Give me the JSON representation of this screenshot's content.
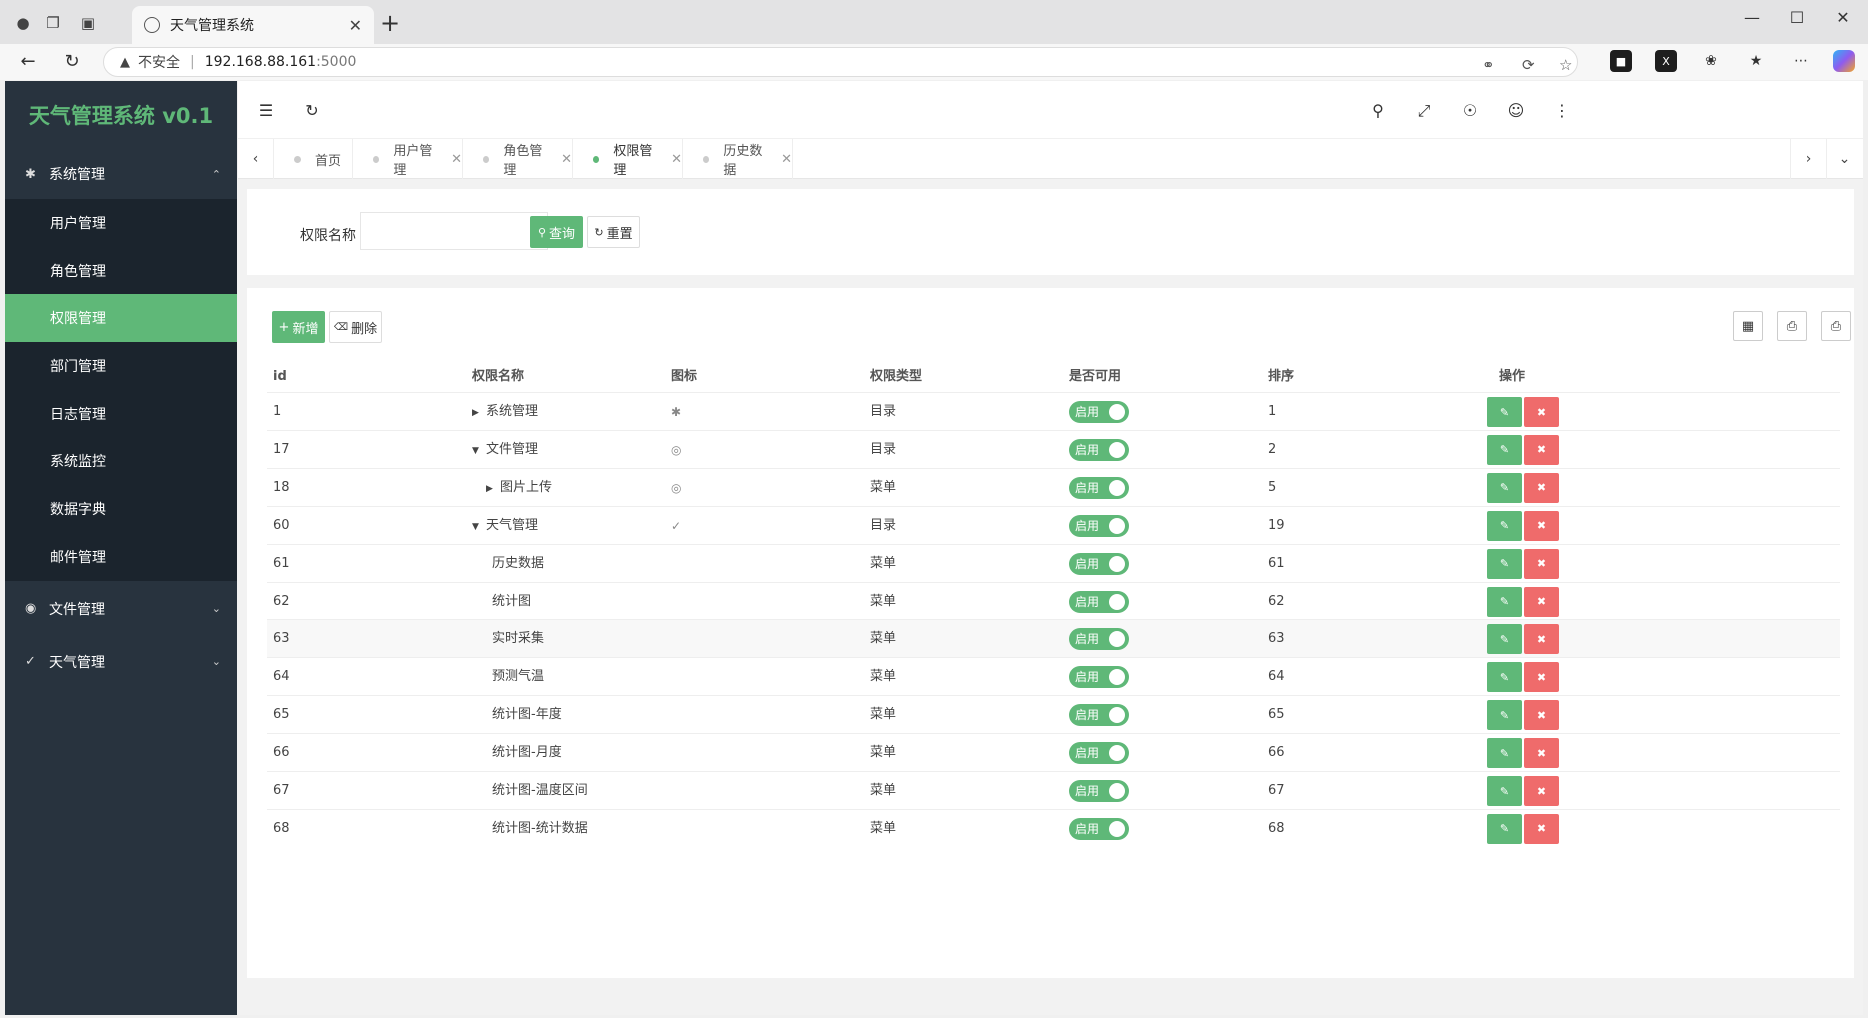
{
  "browser": {
    "tab_title": "天气管理系统",
    "address": {
      "insecure_label": "不安全",
      "host": "192.168.88.161",
      "port": ":5000"
    }
  },
  "sidebar": {
    "brand": "天气管理系统 v0.1",
    "groups": [
      {
        "label": "系统管理",
        "icon": "gear-icon",
        "expanded": true,
        "items": [
          "用户管理",
          "角色管理",
          "权限管理",
          "部门管理",
          "日志管理",
          "系统监控",
          "数据字典",
          "邮件管理"
        ],
        "active_item": "权限管理"
      },
      {
        "label": "文件管理",
        "icon": "camera-icon",
        "expanded": false
      },
      {
        "label": "天气管理",
        "icon": "check-icon",
        "expanded": false
      }
    ]
  },
  "tabs": [
    {
      "label": "首页",
      "closable": false,
      "active": false
    },
    {
      "label": "用户管理",
      "closable": true,
      "active": false
    },
    {
      "label": "角色管理",
      "closable": true,
      "active": false
    },
    {
      "label": "权限管理",
      "closable": true,
      "active": true
    },
    {
      "label": "历史数据",
      "closable": true,
      "active": false
    }
  ],
  "search": {
    "label": "权限名称",
    "value": "",
    "query_button": "查询",
    "reset_button": "重置"
  },
  "toolbar": {
    "add_button": "新增",
    "delete_button": "删除"
  },
  "table": {
    "columns": [
      "id",
      "权限名称",
      "图标",
      "权限类型",
      "是否可用",
      "排序",
      "操作"
    ],
    "switch_label": "启用",
    "rows": [
      {
        "id": "1",
        "name": "系统管理",
        "icon": "gear-icon",
        "caret": "collapsed",
        "indent": 0,
        "type": "目录",
        "enabled": true,
        "sort": "1"
      },
      {
        "id": "17",
        "name": "文件管理",
        "icon": "camera-icon",
        "caret": "expanded",
        "indent": 0,
        "type": "目录",
        "enabled": true,
        "sort": "2"
      },
      {
        "id": "18",
        "name": "图片上传",
        "icon": "camera-icon",
        "caret": "collapsed",
        "indent": 1,
        "type": "菜单",
        "enabled": true,
        "sort": "5"
      },
      {
        "id": "60",
        "name": "天气管理",
        "icon": "check-icon",
        "caret": "expanded",
        "indent": 0,
        "type": "目录",
        "enabled": true,
        "sort": "19"
      },
      {
        "id": "61",
        "name": "历史数据",
        "icon": "",
        "caret": "",
        "indent": 1,
        "type": "菜单",
        "enabled": true,
        "sort": "61"
      },
      {
        "id": "62",
        "name": "统计图",
        "icon": "",
        "caret": "",
        "indent": 1,
        "type": "菜单",
        "enabled": true,
        "sort": "62"
      },
      {
        "id": "63",
        "name": "实时采集",
        "icon": "",
        "caret": "",
        "indent": 1,
        "type": "菜单",
        "enabled": true,
        "sort": "63"
      },
      {
        "id": "64",
        "name": "预测气温",
        "icon": "",
        "caret": "",
        "indent": 1,
        "type": "菜单",
        "enabled": true,
        "sort": "64"
      },
      {
        "id": "65",
        "name": "统计图-年度",
        "icon": "",
        "caret": "",
        "indent": 1,
        "type": "菜单",
        "enabled": true,
        "sort": "65"
      },
      {
        "id": "66",
        "name": "统计图-月度",
        "icon": "",
        "caret": "",
        "indent": 1,
        "type": "菜单",
        "enabled": true,
        "sort": "66"
      },
      {
        "id": "67",
        "name": "统计图-温度区间",
        "icon": "",
        "caret": "",
        "indent": 1,
        "type": "菜单",
        "enabled": true,
        "sort": "67"
      },
      {
        "id": "68",
        "name": "统计图-统计数据",
        "icon": "",
        "caret": "",
        "indent": 1,
        "type": "菜单",
        "enabled": true,
        "sort": "68"
      }
    ],
    "hovered_row": "63"
  },
  "colors": {
    "accent": "#5fb878",
    "danger": "#ef6b6b",
    "sidebar_bg": "#28333e",
    "sidebar_sub_bg": "#1b242d"
  }
}
